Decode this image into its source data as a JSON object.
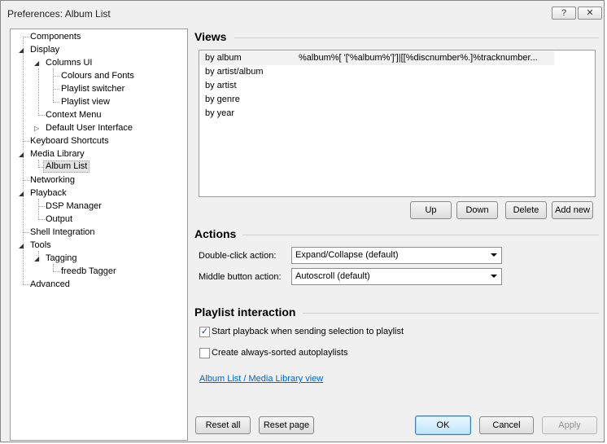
{
  "window": {
    "title": "Preferences: Album List",
    "help_label": "?",
    "close_label": "✕"
  },
  "tree": {
    "items": [
      {
        "label": "Components"
      },
      {
        "label": "Display"
      },
      {
        "label": "Columns UI"
      },
      {
        "label": "Colours and Fonts"
      },
      {
        "label": "Playlist switcher"
      },
      {
        "label": "Playlist view"
      },
      {
        "label": "Context Menu"
      },
      {
        "label": "Default User Interface"
      },
      {
        "label": "Keyboard Shortcuts"
      },
      {
        "label": "Media Library"
      },
      {
        "label": "Album List"
      },
      {
        "label": "Networking"
      },
      {
        "label": "Playback"
      },
      {
        "label": "DSP Manager"
      },
      {
        "label": "Output"
      },
      {
        "label": "Shell Integration"
      },
      {
        "label": "Tools"
      },
      {
        "label": "Tagging"
      },
      {
        "label": "freedb Tagger"
      },
      {
        "label": "Advanced"
      }
    ],
    "selected": "Album List"
  },
  "views": {
    "title": "Views",
    "rows": [
      {
        "name": "by album",
        "value": "%album%[ '['%album%']']|[[%discnumber%.]%tracknumber..."
      },
      {
        "name": "by artist/album",
        "value": ""
      },
      {
        "name": "by artist",
        "value": ""
      },
      {
        "name": "by genre",
        "value": ""
      },
      {
        "name": "by year",
        "value": ""
      }
    ],
    "buttons": {
      "up": "Up",
      "down": "Down",
      "delete": "Delete",
      "add_new": "Add new"
    }
  },
  "actions": {
    "title": "Actions",
    "double_click_label": "Double-click action:",
    "double_click_value": "Expand/Collapse (default)",
    "middle_button_label": "Middle button action:",
    "middle_button_value": "Autoscroll (default)"
  },
  "playlist_interaction": {
    "title": "Playlist interaction",
    "start_playback_label": "Start playback when sending selection to playlist",
    "start_playback_checked": true,
    "always_sorted_label": "Create always-sorted autoplaylists",
    "always_sorted_checked": false,
    "link_text": "Album List / Media Library view"
  },
  "footer": {
    "reset_all": "Reset all",
    "reset_page": "Reset page",
    "ok": "OK",
    "cancel": "Cancel",
    "apply": "Apply"
  },
  "colors": {
    "link": "#0066cc",
    "default_button_border": "#3c7fb1"
  }
}
